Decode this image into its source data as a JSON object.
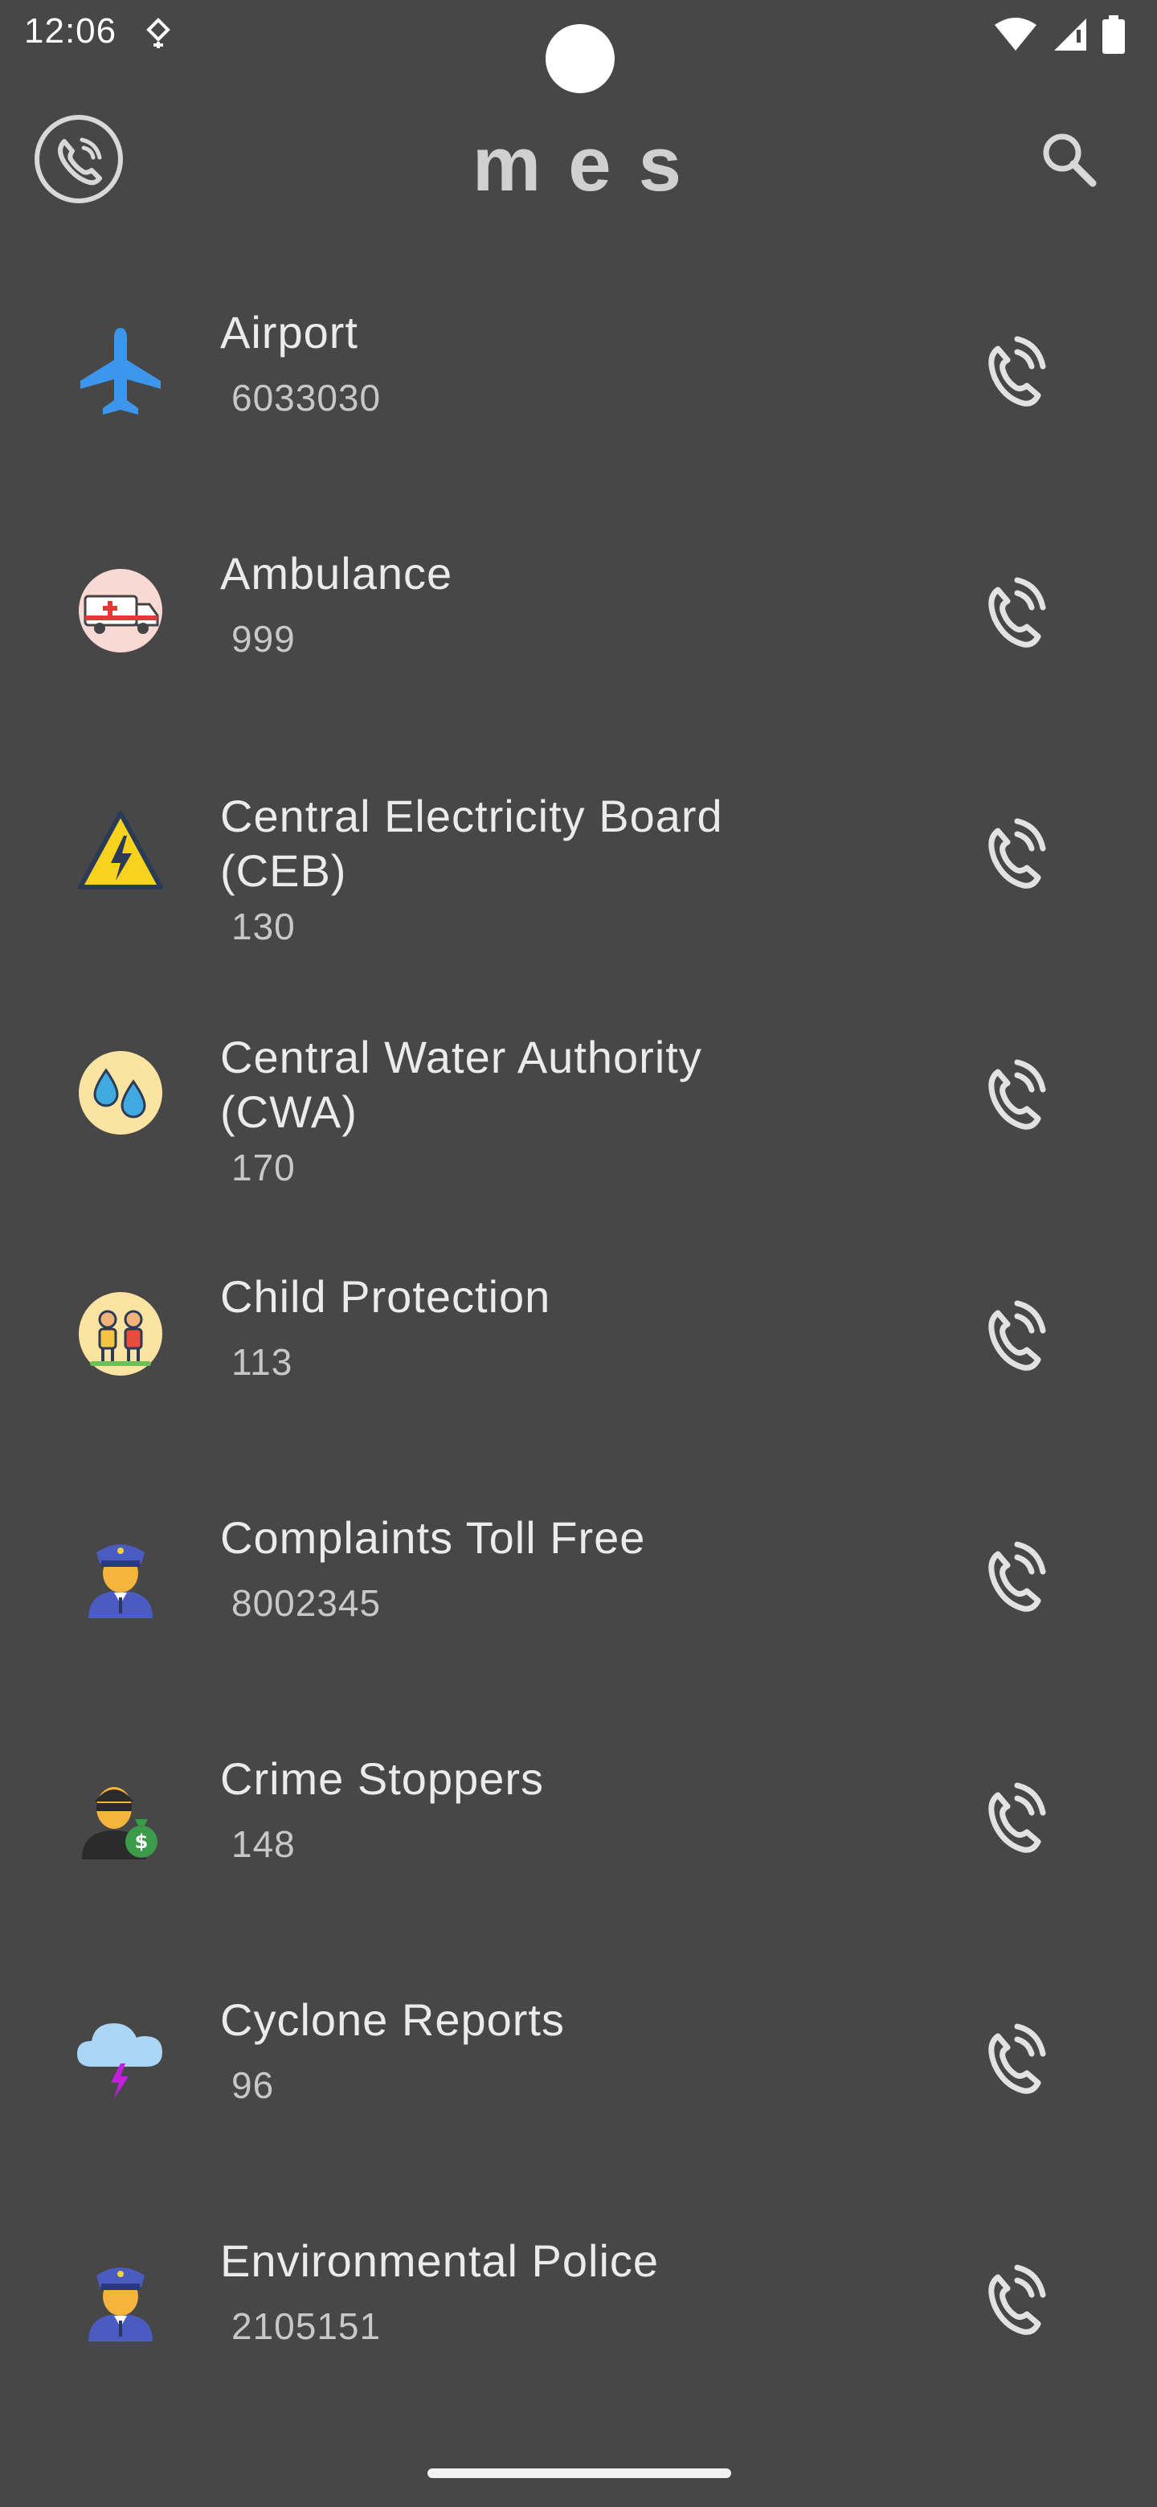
{
  "status_bar": {
    "time": "12:06"
  },
  "app": {
    "title": "mes"
  },
  "icons": {
    "logo": "phone-ringing-logo-icon",
    "search": "search-icon",
    "call": "phone-call-icon"
  },
  "contacts": [
    {
      "name": "Airport",
      "number": "6033030",
      "icon": "airplane-icon"
    },
    {
      "name": "Ambulance",
      "number": "999",
      "icon": "ambulance-icon"
    },
    {
      "name": "Central Electricity Board (CEB)",
      "number": "130",
      "icon": "electric-warning-icon"
    },
    {
      "name": "Central Water Authority (CWA)",
      "number": "170",
      "icon": "water-drops-icon"
    },
    {
      "name": "Child Protection",
      "number": "113",
      "icon": "children-icon"
    },
    {
      "name": "Complaints Toll Free",
      "number": "8002345",
      "icon": "police-officer-icon"
    },
    {
      "name": "Crime Stoppers",
      "number": "148",
      "icon": "thief-icon"
    },
    {
      "name": "Cyclone Reports",
      "number": "96",
      "icon": "storm-cloud-icon"
    },
    {
      "name": "Environmental Police",
      "number": "2105151",
      "icon": "police-officer-icon"
    }
  ]
}
